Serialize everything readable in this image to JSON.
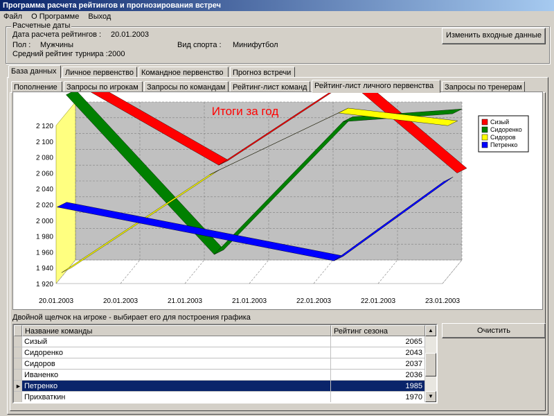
{
  "window": {
    "title": "Программа расчета рейтингов и прогнозирования встреч"
  },
  "menu": [
    "Файл",
    "О Программе",
    "Выход"
  ],
  "dates_group": {
    "caption": "Расчетные даты",
    "calc_date_label": "Дата расчета рейтингов :",
    "calc_date_value": "20.01.2003",
    "gender_label": "Пол :",
    "gender_value": "Мужчины",
    "sport_label": "Вид спорта :",
    "sport_value": "Минифутбол",
    "avg_label": "Средний рейтинг турнира :",
    "avg_value": "2000",
    "change_button": "Изменить входные данные"
  },
  "main_tabs": [
    "База данных",
    "Личное первенство",
    "Командное первенство",
    "Прогноз встречи"
  ],
  "sub_tabs": [
    "Пополнение",
    "Запросы по игрокам",
    "Запросы по командам",
    "Рейтинг-лист команд",
    "Рейтинг-лист личного первенства",
    "Запросы по тренерам"
  ],
  "hint": "Двойной щелчок на игроке - выбирает его для построения графика",
  "clear_button": "Очистить",
  "table": {
    "columns": [
      "Название команды",
      "Рейтинг сезона"
    ],
    "rows": [
      {
        "name": "Сизый",
        "rating": "2065"
      },
      {
        "name": "Сидоренко",
        "rating": "2043"
      },
      {
        "name": "Сидоров",
        "rating": "2037"
      },
      {
        "name": "Иваненко",
        "rating": "2036"
      },
      {
        "name": "Петренко",
        "rating": "1985"
      },
      {
        "name": "Прихваткин",
        "rating": "1970"
      }
    ]
  },
  "chart_data": {
    "type": "line",
    "title": "Итоги за год",
    "categories": [
      "20.01.2003",
      "20.01.2003",
      "21.01.2003",
      "21.01.2003",
      "22.01.2003",
      "22.01.2003",
      "23.01.2003"
    ],
    "yticks": [
      "1 920",
      "1 940",
      "1 960",
      "1 980",
      "2 000",
      "2 020",
      "2 040",
      "2 060",
      "2 080",
      "2 100",
      "2 120"
    ],
    "ylim": [
      1920,
      2120
    ],
    "grid": true,
    "legend_position": "right",
    "series": [
      {
        "name": "Сизый",
        "color": "#ff0000",
        "x": [
          0,
          2.3,
          4.3,
          6
        ],
        "values": [
          2147,
          2040,
          2147,
          2030
        ]
      },
      {
        "name": "Сидоренко",
        "color": "#008000",
        "x": [
          0,
          2.3,
          4.3,
          6
        ],
        "values": [
          2136,
          1934,
          2102,
          2112
        ]
      },
      {
        "name": "Сидоров",
        "color": "#ffff00",
        "x": [
          0,
          2.3,
          4.3,
          6
        ],
        "values": [
          1918,
          2042,
          2120,
          2104
        ]
      },
      {
        "name": "Петренко",
        "color": "#0000ff",
        "x": [
          0,
          4.3,
          6
        ],
        "values": [
          2008,
          1940,
          2040
        ]
      }
    ]
  }
}
